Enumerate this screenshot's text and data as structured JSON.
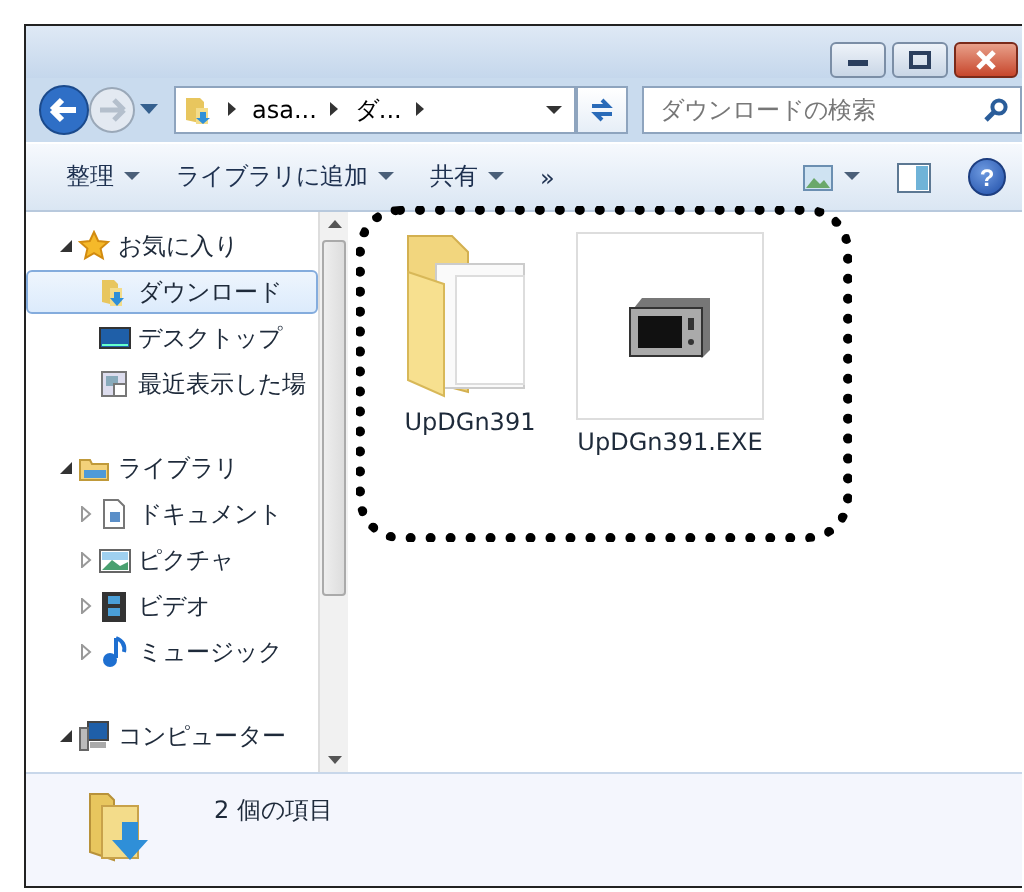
{
  "address_bar": {
    "breadcrumbs": [
      "asa...",
      "ダ..."
    ]
  },
  "search": {
    "placeholder": "ダウンロードの検索"
  },
  "toolbar": [
    {
      "label": "整理",
      "dropdown": true
    },
    {
      "label": "ライブラリに追加",
      "dropdown": true
    },
    {
      "label": "共有",
      "dropdown": true
    },
    {
      "label": "»",
      "dropdown": false
    }
  ],
  "help": {
    "label": "?"
  },
  "sidebar": {
    "items": [
      {
        "label": "お気に入り",
        "kind": "favorites",
        "expanded": true,
        "selected": false,
        "children": [
          {
            "label": "ダウンロード",
            "kind": "downloads",
            "selected": true
          },
          {
            "label": "デスクトップ",
            "kind": "desktop",
            "selected": false
          },
          {
            "label": "最近表示した場",
            "kind": "recent",
            "selected": false
          }
        ]
      },
      {
        "label": "ライブラリ",
        "kind": "library",
        "expanded": true,
        "selected": false,
        "children": [
          {
            "label": "ドキュメント",
            "kind": "documents",
            "expanded": false,
            "selected": false
          },
          {
            "label": "ピクチャ",
            "kind": "pictures",
            "expanded": false,
            "selected": false
          },
          {
            "label": "ビデオ",
            "kind": "video",
            "expanded": false,
            "selected": false
          },
          {
            "label": "ミュージック",
            "kind": "music",
            "expanded": false,
            "selected": false
          }
        ]
      },
      {
        "label": "コンピューター",
        "kind": "computer",
        "expanded": true,
        "selected": false
      }
    ]
  },
  "files": [
    {
      "name": "UpDGn391",
      "kind": "folder",
      "selected": false
    },
    {
      "name": "UpDGn391.EXE",
      "kind": "exe",
      "selected": false
    }
  ],
  "status_bar": {
    "text": "2 個の項目"
  }
}
